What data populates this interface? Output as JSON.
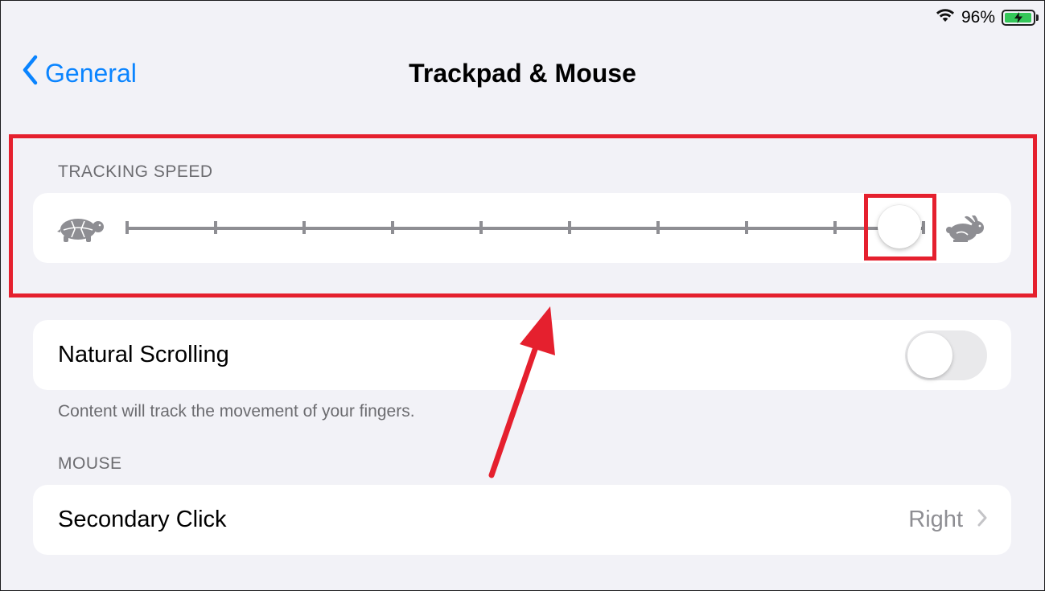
{
  "status_bar": {
    "battery_percent": "96%",
    "battery_level": 0.96,
    "icons": [
      "wifi-icon",
      "battery-charging-icon"
    ],
    "battery_color": "#34c759"
  },
  "nav": {
    "back_label": "General",
    "title": "Trackpad & Mouse",
    "accent_color": "#0a84ff"
  },
  "tracking_speed": {
    "header": "TRACKING SPEED",
    "slow_icon": "turtle-icon",
    "fast_icon": "rabbit-icon",
    "tick_count": 10,
    "value_fraction": 0.97
  },
  "natural_scrolling": {
    "label": "Natural Scrolling",
    "enabled": false,
    "footer": "Content will track the movement of your fingers."
  },
  "mouse": {
    "header": "MOUSE",
    "secondary_click_label": "Secondary Click",
    "secondary_click_value": "Right"
  },
  "annotations": {
    "highlight_color": "#e5202e"
  }
}
